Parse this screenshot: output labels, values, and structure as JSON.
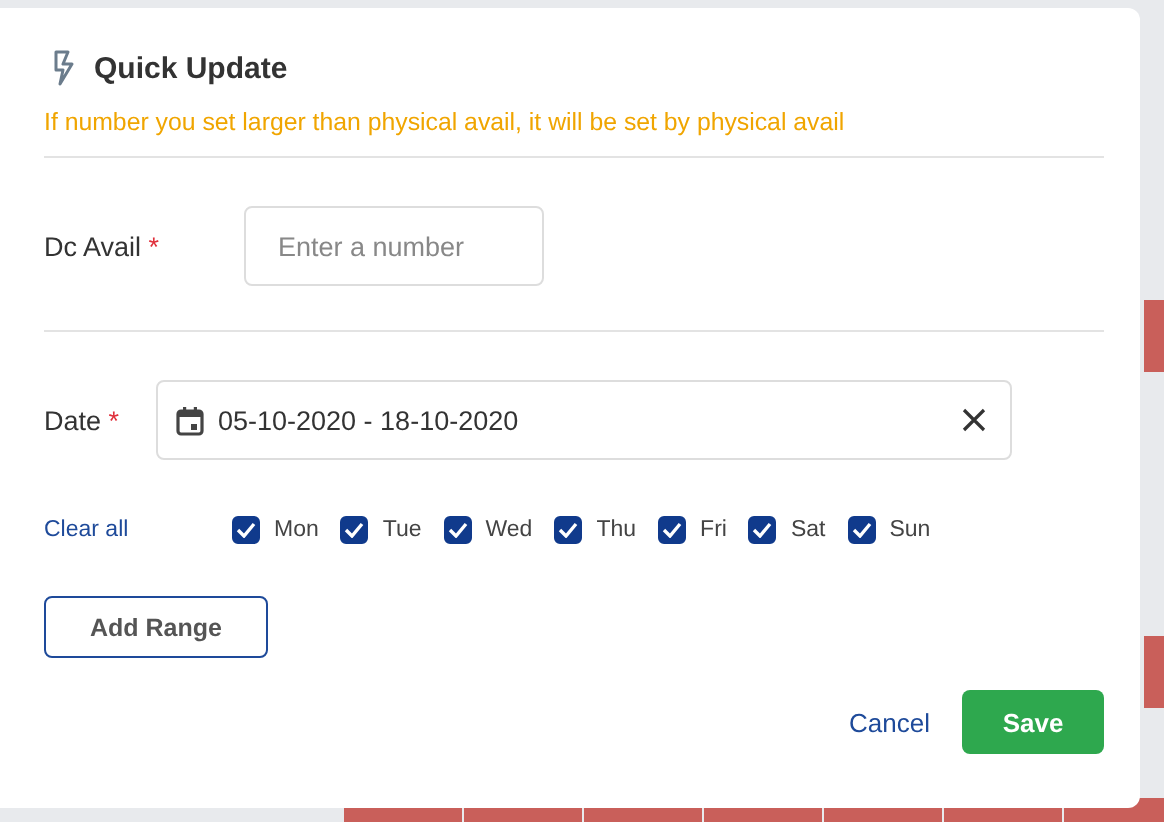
{
  "dialog": {
    "title": "Quick Update",
    "notice": "If number you set larger than physical avail, it will be set by physical avail"
  },
  "dc_avail": {
    "label": "Dc Avail",
    "required_mark": "*",
    "placeholder": "Enter a number"
  },
  "date": {
    "label": "Date",
    "required_mark": "*",
    "value": "05-10-2020 - 18-10-2020"
  },
  "clear_all": "Clear all",
  "days": [
    {
      "label": "Mon",
      "checked": true
    },
    {
      "label": "Tue",
      "checked": true
    },
    {
      "label": "Wed",
      "checked": true
    },
    {
      "label": "Thu",
      "checked": true
    },
    {
      "label": "Fri",
      "checked": true
    },
    {
      "label": "Sat",
      "checked": true
    },
    {
      "label": "Sun",
      "checked": true
    }
  ],
  "buttons": {
    "add_range": "Add Range",
    "cancel": "Cancel",
    "save": "Save"
  }
}
